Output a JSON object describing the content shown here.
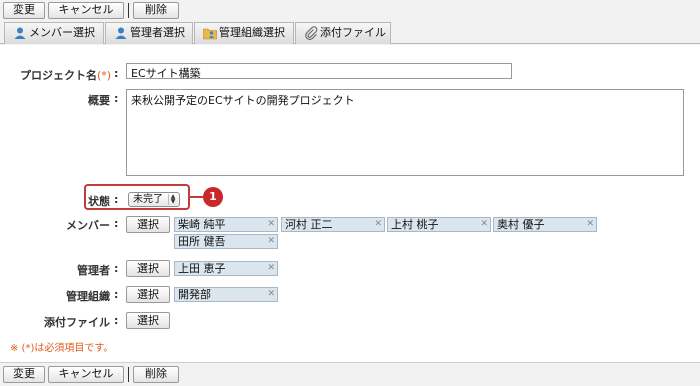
{
  "toolbar": {
    "change": "変更",
    "cancel": "キャンセル",
    "delete": "削除"
  },
  "tabs": [
    {
      "label": "メンバー選択",
      "icon": "user-icon"
    },
    {
      "label": "管理者選択",
      "icon": "user-icon"
    },
    {
      "label": "管理組織選択",
      "icon": "folder-users-icon"
    },
    {
      "label": "添付ファイル",
      "icon": "paperclip-icon"
    }
  ],
  "form": {
    "project_name_label": "プロジェクト名",
    "required_mark": "(*)",
    "project_name_value": "ECサイト構築",
    "summary_label": "概要",
    "summary_value": "来秋公開予定のECサイトの開発プロジェクト",
    "status_label": "状態",
    "status_value": "未完了",
    "members_label": "メンバー",
    "members": [
      "柴崎 純平",
      "河村 正二",
      "上村 桃子",
      "奥村 優子",
      "田所 健吾"
    ],
    "managers_label": "管理者",
    "managers": [
      "上田 恵子"
    ],
    "org_label": "管理組織",
    "orgs": [
      "開発部"
    ],
    "attach_label": "添付ファイル",
    "select_button": "選択",
    "colon": ":",
    "note": "※ (*)は必須項目です。"
  },
  "callout": {
    "number": "1"
  },
  "colors": {
    "accent_red": "#c8282a",
    "required_orange": "#e05a1a",
    "chip_bg": "#dbe5ee"
  }
}
